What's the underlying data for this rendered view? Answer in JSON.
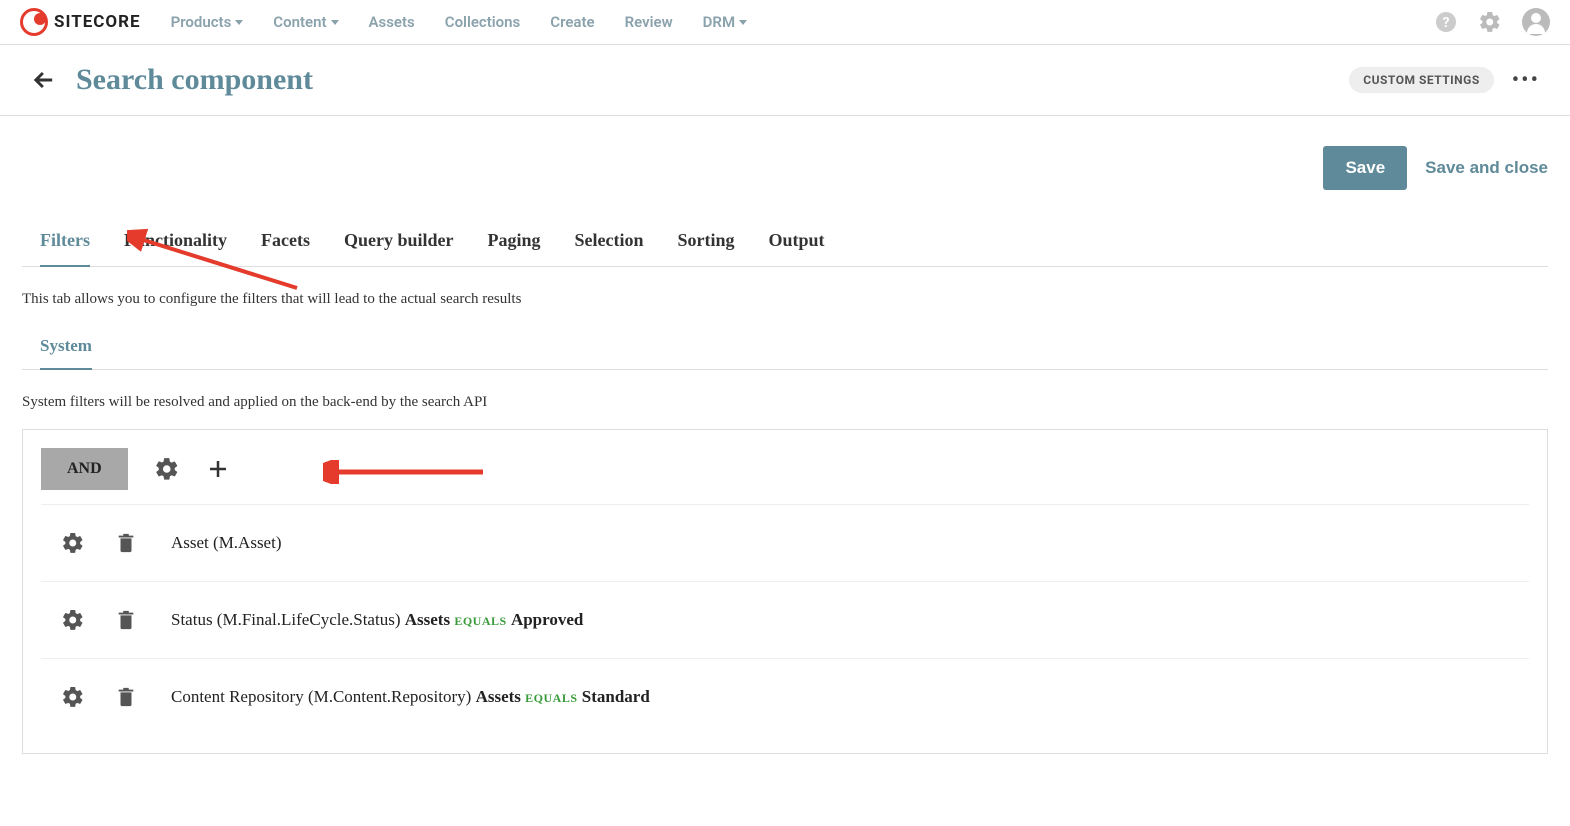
{
  "brand": "SITECORE",
  "nav": {
    "items": [
      {
        "label": "Products",
        "dropdown": true
      },
      {
        "label": "Content",
        "dropdown": true
      },
      {
        "label": "Assets",
        "dropdown": false
      },
      {
        "label": "Collections",
        "dropdown": false
      },
      {
        "label": "Create",
        "dropdown": false
      },
      {
        "label": "Review",
        "dropdown": false
      },
      {
        "label": "DRM",
        "dropdown": true
      }
    ]
  },
  "page": {
    "title": "Search component",
    "custom_settings_label": "CUSTOM SETTINGS"
  },
  "actions": {
    "save": "Save",
    "save_close": "Save and close"
  },
  "tabs": [
    "Filters",
    "Functionality",
    "Facets",
    "Query builder",
    "Paging",
    "Selection",
    "Sorting",
    "Output"
  ],
  "active_tab": 0,
  "tab_description": "This tab allows you to configure the filters that will lead to the actual search results",
  "subtabs": [
    "System"
  ],
  "subtab_description": "System filters will be resolved and applied on the back-end by the search API",
  "filter_group": {
    "operator": "AND",
    "rows": [
      {
        "prefix": "Asset (M.Asset)",
        "subject": "",
        "op": "",
        "value": ""
      },
      {
        "prefix": "Status (M.Final.LifeCycle.Status) ",
        "subject": "Assets",
        "op": "EQUALS",
        "value": "Approved"
      },
      {
        "prefix": "Content Repository (M.Content.Repository) ",
        "subject": "Assets",
        "op": "EQUALS",
        "value": "Standard"
      }
    ]
  }
}
